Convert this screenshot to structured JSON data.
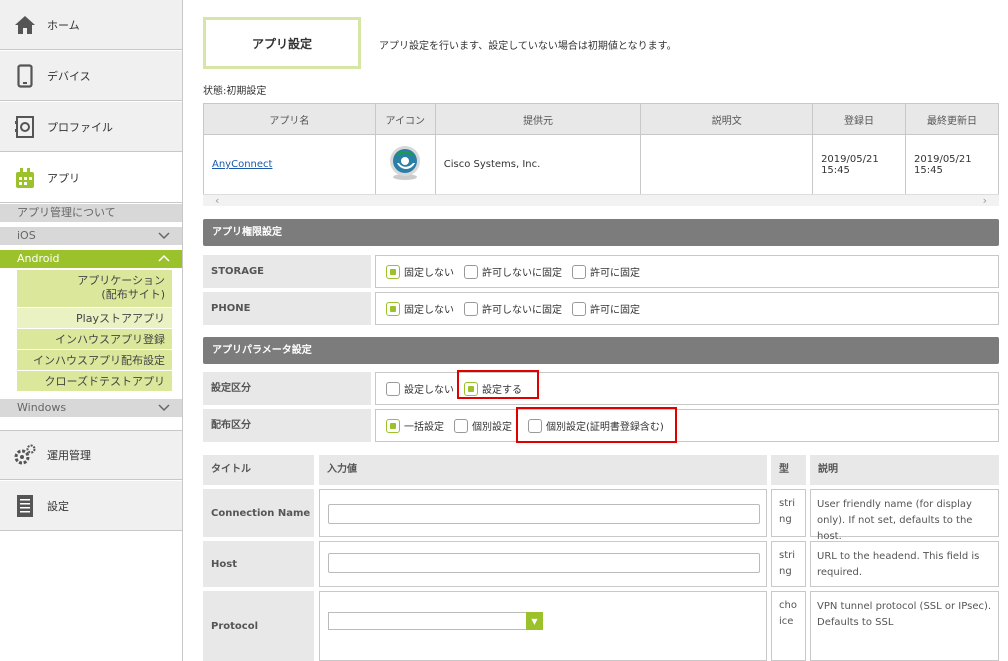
{
  "sidebar": {
    "items": [
      {
        "label": "ホーム",
        "icon": "home-icon"
      },
      {
        "label": "デバイス",
        "icon": "device-icon"
      },
      {
        "label": "プロファイル",
        "icon": "profile-icon"
      },
      {
        "label": "アプリ",
        "icon": "app-icon"
      }
    ],
    "app_about": "アプリ管理について",
    "ios": "iOS",
    "android": "Android",
    "android_items": [
      "アプリケーション\n(配布サイト)",
      "Playストアアプリ",
      "インハウスアプリ登録",
      "インハウスアプリ配布設定",
      "クローズドテストアプリ"
    ],
    "android_item_1a": "アプリケーション",
    "android_item_1b": "(配布サイト)",
    "windows": "Windows",
    "ops": "運用管理",
    "settings": "設定",
    "accent_color": "#9bc12b"
  },
  "page": {
    "title": "アプリ設定",
    "description": "アプリ設定を行います、設定していない場合は初期値となります。",
    "status": "状態:初期設定"
  },
  "app_table": {
    "headers": [
      "アプリ名",
      "アイコン",
      "提供元",
      "説明文",
      "登録日",
      "最終更新日"
    ],
    "rows": [
      {
        "name": "AnyConnect",
        "provider": "Cisco Systems, Inc.",
        "description": "",
        "registered_date": "2019/05/21",
        "registered_time": "15:45",
        "updated_date": "2019/05/21",
        "updated_time": "15:45"
      }
    ]
  },
  "permissions": {
    "section_title": "アプリ権限設定",
    "rows": [
      {
        "label": "STORAGE",
        "options": [
          "固定しない",
          "許可しないに固定",
          "許可に固定"
        ],
        "selected": 0
      },
      {
        "label": "PHONE",
        "options": [
          "固定しない",
          "許可しないに固定",
          "許可に固定"
        ],
        "selected": 0
      }
    ]
  },
  "params": {
    "section_title": "アプリパラメータ設定",
    "setting_label": "設定区分",
    "setting_options": [
      "設定しない",
      "設定する"
    ],
    "setting_selected": 1,
    "dist_label": "配布区分",
    "dist_options": [
      "一括設定",
      "個別設定",
      "個別設定(証明書登録含む)"
    ],
    "dist_selected": 0,
    "headers": [
      "タイトル",
      "入力値",
      "型",
      "説明"
    ],
    "rows": [
      {
        "title": "Connection Name",
        "type": "string",
        "description": "User friendly name (for display only). If not set, defaults to the host."
      },
      {
        "title": "Host",
        "type": "string",
        "description": "URL to the headend. This field is required."
      },
      {
        "title": "Protocol",
        "type": "choice",
        "description": "VPN tunnel protocol (SSL or IPsec). Defaults to SSL"
      }
    ]
  }
}
